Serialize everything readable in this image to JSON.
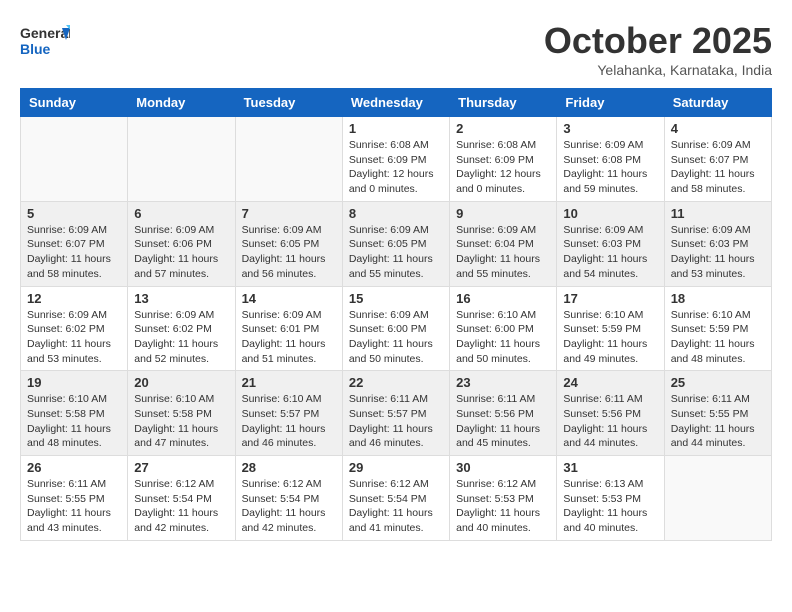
{
  "header": {
    "logo_general": "General",
    "logo_blue": "Blue",
    "month": "October 2025",
    "location": "Yelahanka, Karnataka, India"
  },
  "days_of_week": [
    "Sunday",
    "Monday",
    "Tuesday",
    "Wednesday",
    "Thursday",
    "Friday",
    "Saturday"
  ],
  "weeks": [
    [
      {
        "day": "",
        "info": ""
      },
      {
        "day": "",
        "info": ""
      },
      {
        "day": "",
        "info": ""
      },
      {
        "day": "1",
        "info": "Sunrise: 6:08 AM\nSunset: 6:09 PM\nDaylight: 12 hours\nand 0 minutes."
      },
      {
        "day": "2",
        "info": "Sunrise: 6:08 AM\nSunset: 6:09 PM\nDaylight: 12 hours\nand 0 minutes."
      },
      {
        "day": "3",
        "info": "Sunrise: 6:09 AM\nSunset: 6:08 PM\nDaylight: 11 hours\nand 59 minutes."
      },
      {
        "day": "4",
        "info": "Sunrise: 6:09 AM\nSunset: 6:07 PM\nDaylight: 11 hours\nand 58 minutes."
      }
    ],
    [
      {
        "day": "5",
        "info": "Sunrise: 6:09 AM\nSunset: 6:07 PM\nDaylight: 11 hours\nand 58 minutes."
      },
      {
        "day": "6",
        "info": "Sunrise: 6:09 AM\nSunset: 6:06 PM\nDaylight: 11 hours\nand 57 minutes."
      },
      {
        "day": "7",
        "info": "Sunrise: 6:09 AM\nSunset: 6:05 PM\nDaylight: 11 hours\nand 56 minutes."
      },
      {
        "day": "8",
        "info": "Sunrise: 6:09 AM\nSunset: 6:05 PM\nDaylight: 11 hours\nand 55 minutes."
      },
      {
        "day": "9",
        "info": "Sunrise: 6:09 AM\nSunset: 6:04 PM\nDaylight: 11 hours\nand 55 minutes."
      },
      {
        "day": "10",
        "info": "Sunrise: 6:09 AM\nSunset: 6:03 PM\nDaylight: 11 hours\nand 54 minutes."
      },
      {
        "day": "11",
        "info": "Sunrise: 6:09 AM\nSunset: 6:03 PM\nDaylight: 11 hours\nand 53 minutes."
      }
    ],
    [
      {
        "day": "12",
        "info": "Sunrise: 6:09 AM\nSunset: 6:02 PM\nDaylight: 11 hours\nand 53 minutes."
      },
      {
        "day": "13",
        "info": "Sunrise: 6:09 AM\nSunset: 6:02 PM\nDaylight: 11 hours\nand 52 minutes."
      },
      {
        "day": "14",
        "info": "Sunrise: 6:09 AM\nSunset: 6:01 PM\nDaylight: 11 hours\nand 51 minutes."
      },
      {
        "day": "15",
        "info": "Sunrise: 6:09 AM\nSunset: 6:00 PM\nDaylight: 11 hours\nand 50 minutes."
      },
      {
        "day": "16",
        "info": "Sunrise: 6:10 AM\nSunset: 6:00 PM\nDaylight: 11 hours\nand 50 minutes."
      },
      {
        "day": "17",
        "info": "Sunrise: 6:10 AM\nSunset: 5:59 PM\nDaylight: 11 hours\nand 49 minutes."
      },
      {
        "day": "18",
        "info": "Sunrise: 6:10 AM\nSunset: 5:59 PM\nDaylight: 11 hours\nand 48 minutes."
      }
    ],
    [
      {
        "day": "19",
        "info": "Sunrise: 6:10 AM\nSunset: 5:58 PM\nDaylight: 11 hours\nand 48 minutes."
      },
      {
        "day": "20",
        "info": "Sunrise: 6:10 AM\nSunset: 5:58 PM\nDaylight: 11 hours\nand 47 minutes."
      },
      {
        "day": "21",
        "info": "Sunrise: 6:10 AM\nSunset: 5:57 PM\nDaylight: 11 hours\nand 46 minutes."
      },
      {
        "day": "22",
        "info": "Sunrise: 6:11 AM\nSunset: 5:57 PM\nDaylight: 11 hours\nand 46 minutes."
      },
      {
        "day": "23",
        "info": "Sunrise: 6:11 AM\nSunset: 5:56 PM\nDaylight: 11 hours\nand 45 minutes."
      },
      {
        "day": "24",
        "info": "Sunrise: 6:11 AM\nSunset: 5:56 PM\nDaylight: 11 hours\nand 44 minutes."
      },
      {
        "day": "25",
        "info": "Sunrise: 6:11 AM\nSunset: 5:55 PM\nDaylight: 11 hours\nand 44 minutes."
      }
    ],
    [
      {
        "day": "26",
        "info": "Sunrise: 6:11 AM\nSunset: 5:55 PM\nDaylight: 11 hours\nand 43 minutes."
      },
      {
        "day": "27",
        "info": "Sunrise: 6:12 AM\nSunset: 5:54 PM\nDaylight: 11 hours\nand 42 minutes."
      },
      {
        "day": "28",
        "info": "Sunrise: 6:12 AM\nSunset: 5:54 PM\nDaylight: 11 hours\nand 42 minutes."
      },
      {
        "day": "29",
        "info": "Sunrise: 6:12 AM\nSunset: 5:54 PM\nDaylight: 11 hours\nand 41 minutes."
      },
      {
        "day": "30",
        "info": "Sunrise: 6:12 AM\nSunset: 5:53 PM\nDaylight: 11 hours\nand 40 minutes."
      },
      {
        "day": "31",
        "info": "Sunrise: 6:13 AM\nSunset: 5:53 PM\nDaylight: 11 hours\nand 40 minutes."
      },
      {
        "day": "",
        "info": ""
      }
    ]
  ]
}
